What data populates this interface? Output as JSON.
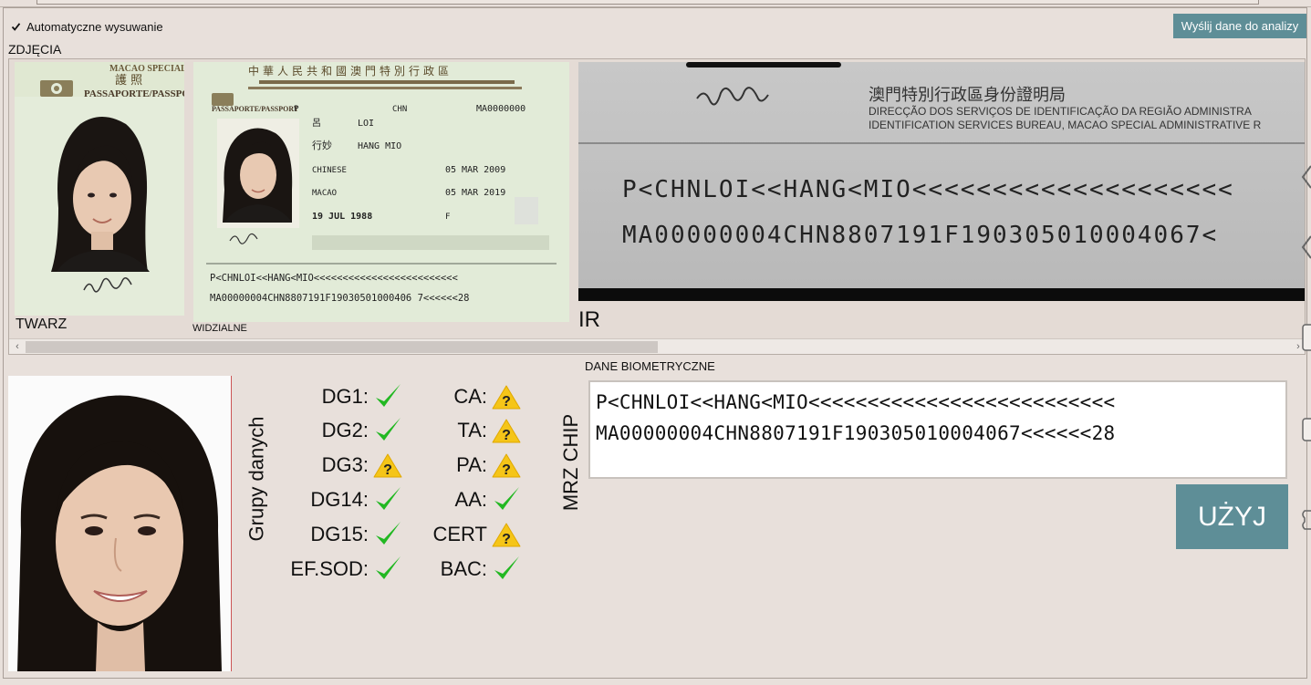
{
  "header": {
    "auto_read_label": "Automatyczne wysuwanie",
    "auto_read_checked": true,
    "send_button_label": "Wyślij dane do analizy"
  },
  "photos": {
    "section_label": "ZDJĘCIA",
    "face_label": "TWARZ",
    "visible_label": "WIDZIALNE",
    "ir_label": "IR",
    "scroll_fraction": 0.49,
    "passport_texts": {
      "header_zh": "中華人民共和國澳門特別行政區",
      "macao_special": "MACAO SPECIAL",
      "huzhao": "護 照",
      "passport_word": "PASSAPORTE/PASSPORT",
      "type": "P",
      "country": "CHN",
      "number": "MA0000000",
      "surname": "LOI",
      "surname_zh": "呂",
      "given_names": "HANG MIO",
      "given_names_zh": "行妙",
      "nationality": "CHINESE",
      "place_of_birth": "MACAO",
      "date_of_birth": "19 JUL 1988",
      "issue_date": "05 MAR 2009",
      "expiry_date": "05 MAR 2019",
      "sex": "F",
      "mrz_line1": "P<CHNLOI<<HANG<MIO<<<<<<<<<<<<<<<<<<<<<<<<<",
      "mrz_line2": "MA00000004CHN8807191F19030501000406 7<<<<<<28"
    },
    "ir_texts": {
      "bureau_zh": "澳門特別行政區身份證明局",
      "bureau_pt": "DIRECÇÃO DOS SERVIÇOS DE IDENTIFICAÇÃO DA REGIÃO ADMINISTRA",
      "bureau_en": "IDENTIFICATION SERVICES BUREAU, MACAO SPECIAL ADMINISTRATIVE R",
      "mrz_line1": "P<CHNLOI<<HANG<MIO<<<<<<<<<<<<<<<<<<<<",
      "mrz_line2": "MA00000004CHN8807191F190305010004067<"
    }
  },
  "biometric": {
    "section_label": "DANE BIOMETRYCZNE",
    "groups_title": "Grupy danych",
    "mrz_title": "MRZ CHIP",
    "data_groups": [
      {
        "label": "DG1:",
        "status": "ok"
      },
      {
        "label": "DG2:",
        "status": "ok"
      },
      {
        "label": "DG3:",
        "status": "warn"
      },
      {
        "label": "DG14:",
        "status": "ok"
      },
      {
        "label": "DG15:",
        "status": "ok"
      },
      {
        "label": "EF.SOD:",
        "status": "ok"
      }
    ],
    "checks": [
      {
        "label": "CA:",
        "status": "warn"
      },
      {
        "label": "TA:",
        "status": "warn"
      },
      {
        "label": "PA:",
        "status": "warn"
      },
      {
        "label": "AA:",
        "status": "ok"
      },
      {
        "label": "CERT",
        "status": "warn"
      },
      {
        "label": "BAC:",
        "status": "ok"
      }
    ],
    "mrz_line1": "P<CHNLOI<<HANG<MIO<<<<<<<<<<<<<<<<<<<<<<<<<<",
    "mrz_line2": "MA00000004CHN8807191F190305010004067<<<<<<28",
    "use_button_label": "UŻYJ"
  },
  "colors": {
    "background": "#e8e0db",
    "accent_button": "#5e8e97",
    "ok_green": "#22b822",
    "warn_yellow": "#f5c518"
  }
}
